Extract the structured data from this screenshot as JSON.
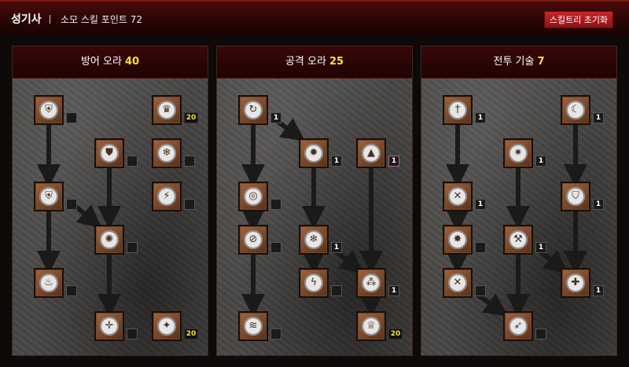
{
  "header": {
    "title": "성기사",
    "points_label": "소모 스킬 포인트 72",
    "reset_label": "스킬트리 초기화"
  },
  "panels": [
    {
      "name": "방어 오라",
      "points": "40",
      "skills": [
        {
          "icon": "wing-shield-icon",
          "glyph": "⛨",
          "badge": ""
        },
        {
          "icon": "crown-icon",
          "glyph": "♛",
          "badge": "20"
        },
        {
          "icon": "shield-icon",
          "glyph": "⛊",
          "badge": ""
        },
        {
          "icon": "frost-icon",
          "glyph": "❄",
          "badge": ""
        },
        {
          "icon": "wing-shield-icon",
          "glyph": "⛨",
          "badge": ""
        },
        {
          "icon": "lightning-icon",
          "glyph": "⚡",
          "badge": ""
        },
        {
          "icon": "spiral-icon",
          "glyph": "✺",
          "badge": ""
        },
        {
          "icon": "flame-icon",
          "glyph": "♨",
          "badge": ""
        },
        {
          "icon": "cross-circle-icon",
          "glyph": "✛",
          "badge": ""
        },
        {
          "icon": "compass-icon",
          "glyph": "✦",
          "badge": "20"
        }
      ]
    },
    {
      "name": "공격 오라",
      "points": "25",
      "skills": [
        {
          "icon": "swirl-icon",
          "glyph": "↻",
          "badge": "1"
        },
        {
          "icon": "fire-claw-icon",
          "glyph": "✹",
          "badge": "1"
        },
        {
          "icon": "mountain-icon",
          "glyph": "▲",
          "badge": "1"
        },
        {
          "icon": "concentric-icon",
          "glyph": "◎",
          "badge": ""
        },
        {
          "icon": "slash-icon",
          "glyph": "⊘",
          "badge": ""
        },
        {
          "icon": "frost-icon",
          "glyph": "❄",
          "badge": "1"
        },
        {
          "icon": "thunder-icon",
          "glyph": "ϟ",
          "badge": ""
        },
        {
          "icon": "trinity-icon",
          "glyph": "⁂",
          "badge": "1"
        },
        {
          "icon": "wave-icon",
          "glyph": "≋",
          "badge": ""
        },
        {
          "icon": "crown-icon",
          "glyph": "♕",
          "badge": "20"
        }
      ]
    },
    {
      "name": "전투 기술",
      "points": "7",
      "skills": [
        {
          "icon": "sword-icon",
          "glyph": "†",
          "badge": "1"
        },
        {
          "icon": "hood-icon",
          "glyph": "☾",
          "badge": "1"
        },
        {
          "icon": "holy-strike-icon",
          "glyph": "✷",
          "badge": "1"
        },
        {
          "icon": "crossed-swords-icon",
          "glyph": "✕",
          "badge": "1"
        },
        {
          "icon": "winged-shield-icon",
          "glyph": "⛉",
          "badge": "1"
        },
        {
          "icon": "smite-icon",
          "glyph": "✸",
          "badge": ""
        },
        {
          "icon": "hammer-icon",
          "glyph": "⚒",
          "badge": "1"
        },
        {
          "icon": "crossed-swords-icon",
          "glyph": "✕",
          "badge": ""
        },
        {
          "icon": "cross-shield-icon",
          "glyph": "✚",
          "badge": "1"
        },
        {
          "icon": "charge-icon",
          "glyph": "➶",
          "badge": ""
        }
      ]
    }
  ]
}
